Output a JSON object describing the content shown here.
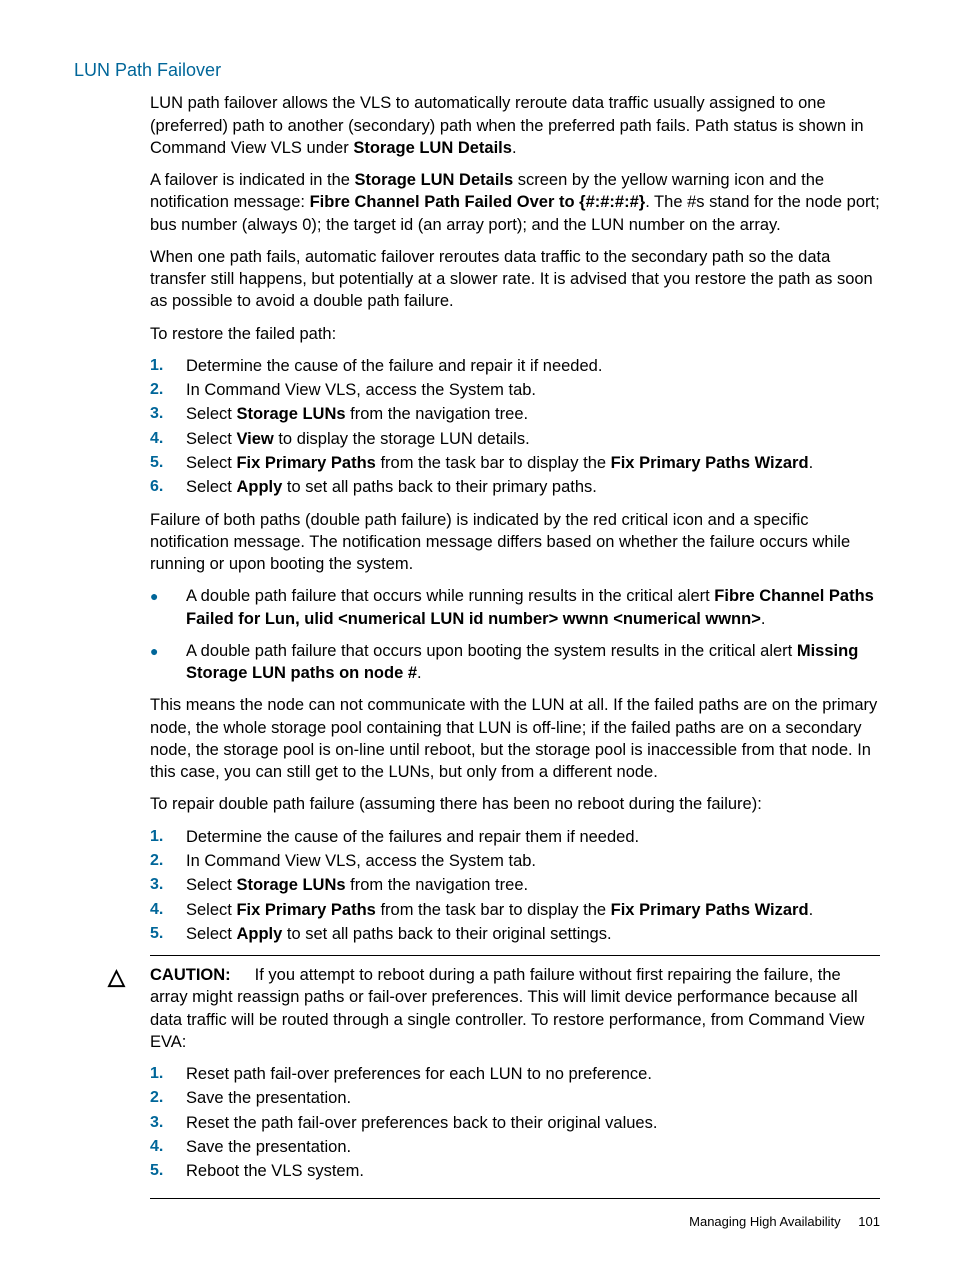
{
  "section_title": "LUN Path Failover",
  "para1": {
    "a": "LUN path failover allows the VLS to automatically reroute data traffic usually assigned to one (preferred) path to another (secondary) path when the preferred path fails. Path status is shown in Command View VLS under ",
    "b": "Storage LUN Details",
    "c": "."
  },
  "para2": {
    "a": "A failover is indicated in the ",
    "b": "Storage LUN Details",
    "c": " screen by the yellow warning icon and the notification message: ",
    "d": "Fibre Channel Path Failed Over to {#:#:#:#}",
    "e": ". The #s stand for the node port; bus number (always 0); the target id (an array port); and the LUN number on the array."
  },
  "para3": "When one path fails, automatic failover reroutes data traffic to the secondary path so the data transfer still happens, but potentially at a slower rate. It is advised that you restore the path as soon as possible to avoid a double path failure.",
  "para4": "To restore the failed path:",
  "list1": {
    "i1": "Determine the cause of the failure and repair it if needed.",
    "i2": "In Command View VLS, access the System tab.",
    "i3a": "Select ",
    "i3b": "Storage LUNs",
    "i3c": " from the navigation tree.",
    "i4a": "Select ",
    "i4b": "View",
    "i4c": " to display the storage LUN details.",
    "i5a": "Select ",
    "i5b": "Fix Primary Paths",
    "i5c": " from the task bar to display the ",
    "i5d": "Fix Primary Paths Wizard",
    "i5e": ".",
    "i6a": "Select ",
    "i6b": "Apply",
    "i6c": " to set all paths back to their primary paths."
  },
  "para5": "Failure of both paths (double path failure) is indicated by the red critical icon and a specific notification message. The notification message differs based on whether the failure occurs while running or upon booting the system.",
  "bul1": {
    "a1": "A double path failure that occurs while running results in the critical alert ",
    "a2": "Fibre Channel Paths Failed for Lun, ulid <numerical LUN id number> wwnn <numerical wwnn>",
    "a3": ".",
    "b1": "A double path failure that occurs upon booting the system results in the critical alert ",
    "b2": "Missing Storage LUN paths on node #",
    "b3": "."
  },
  "para6": "This means the node can not communicate with the LUN at all. If the failed paths are on the primary node, the whole storage pool containing that LUN is off-line; if the failed paths are on a secondary node, the storage pool is on-line until reboot, but the storage pool is inaccessible from that node. In this case, you can still get to the LUNs, but only from a different node.",
  "para7": "To repair double path failure (assuming there has been no reboot during the failure):",
  "list2": {
    "i1": "Determine the cause of the failures and repair them if needed.",
    "i2": "In Command View VLS, access the System tab.",
    "i3a": "Select ",
    "i3b": "Storage LUNs",
    "i3c": " from the navigation tree.",
    "i4a": "Select ",
    "i4b": "Fix Primary Paths",
    "i4c": " from the task bar to display the ",
    "i4d": "Fix Primary Paths Wizard",
    "i4e": ".",
    "i5a": "Select ",
    "i5b": "Apply",
    "i5c": " to set all paths back to their original settings."
  },
  "caution": {
    "label": "CAUTION:",
    "text": "If you attempt to reboot during a path failure without first repairing the failure, the array might reassign paths or fail-over preferences. This will limit device performance because all data traffic will be routed through a single controller. To restore performance, from Command View EVA:",
    "l1": "Reset path fail-over preferences for each LUN to no preference.",
    "l2": "Save the presentation.",
    "l3": "Reset the path fail-over preferences back to their original values.",
    "l4": "Save the presentation.",
    "l5": "Reboot the VLS system."
  },
  "footer": {
    "text": "Managing High Availability",
    "page": "101"
  }
}
